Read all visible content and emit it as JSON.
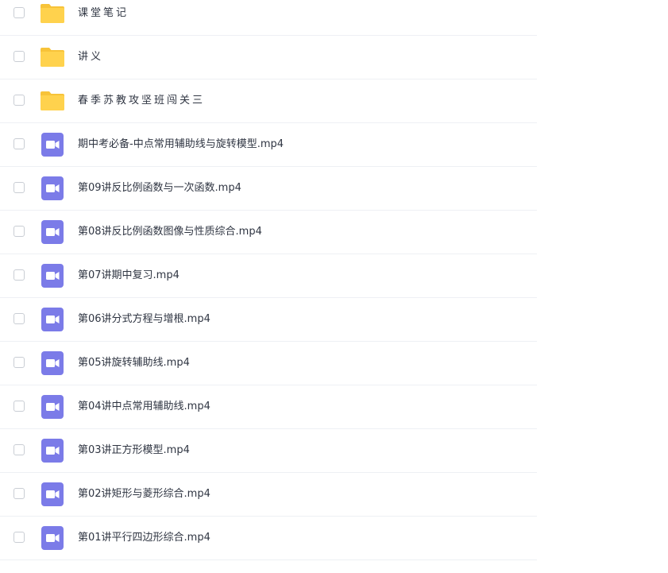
{
  "file_list": {
    "items": [
      {
        "type": "folder",
        "icon": "folder-icon",
        "name": "课堂笔记"
      },
      {
        "type": "folder",
        "icon": "folder-icon",
        "name": "讲义"
      },
      {
        "type": "folder",
        "icon": "folder-icon",
        "name": "春季苏教攻坚班闯关三"
      },
      {
        "type": "video",
        "icon": "video-file-icon",
        "name": "期中考必备-中点常用辅助线与旋转模型.mp4"
      },
      {
        "type": "video",
        "icon": "video-file-icon",
        "name": "第09讲反比例函数与一次函数.mp4"
      },
      {
        "type": "video",
        "icon": "video-file-icon",
        "name": "第08讲反比例函数图像与性质综合.mp4"
      },
      {
        "type": "video",
        "icon": "video-file-icon",
        "name": "第07讲期中复习.mp4"
      },
      {
        "type": "video",
        "icon": "video-file-icon",
        "name": "第06讲分式方程与增根.mp4"
      },
      {
        "type": "video",
        "icon": "video-file-icon",
        "name": "第05讲旋转辅助线.mp4"
      },
      {
        "type": "video",
        "icon": "video-file-icon",
        "name": "第04讲中点常用辅助线.mp4"
      },
      {
        "type": "video",
        "icon": "video-file-icon",
        "name": "第03讲正方形模型.mp4"
      },
      {
        "type": "video",
        "icon": "video-file-icon",
        "name": "第02讲矩形与菱形综合.mp4"
      },
      {
        "type": "video",
        "icon": "video-file-icon",
        "name": "第01讲平行四边形综合.mp4"
      }
    ]
  },
  "colors": {
    "folder": "#FFD24D",
    "folder_tab": "#F7C339",
    "video": "#7B7BE8",
    "text": "#2F3542",
    "divider": "#EEF0F4",
    "checkbox_border": "#C9CDD4"
  }
}
